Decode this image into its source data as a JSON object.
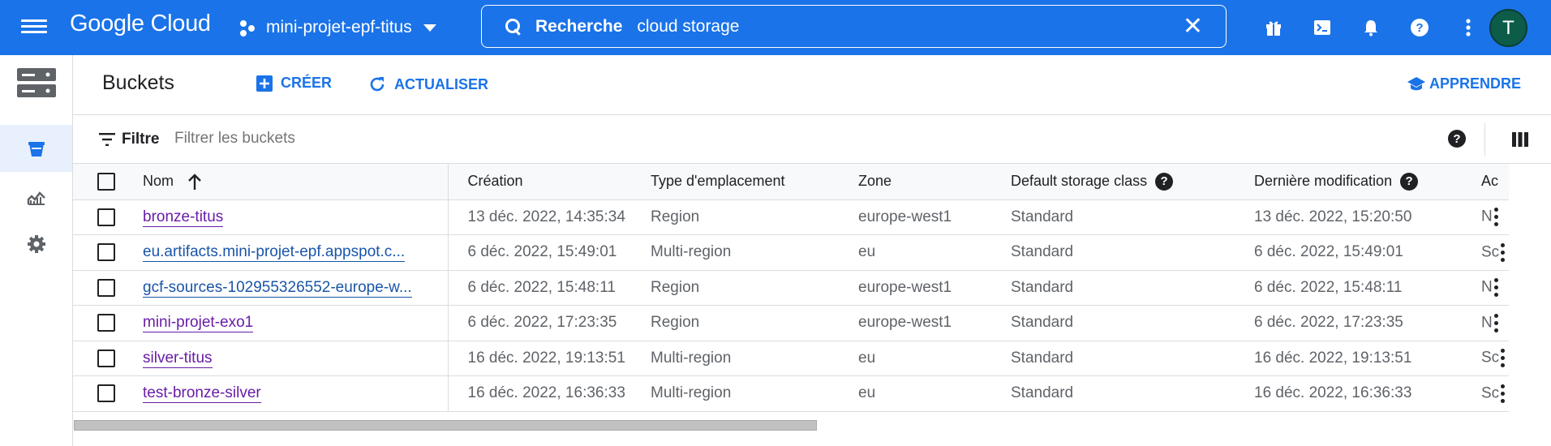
{
  "header": {
    "logo": "Google Cloud",
    "project": "mini-projet-epf-titus",
    "search_label": "Recherche",
    "search_value": "cloud storage",
    "avatar_letter": "T"
  },
  "toolbar": {
    "title": "Buckets",
    "create_label": "CRÉER",
    "refresh_label": "ACTUALISER",
    "learn_label": "APPRENDRE"
  },
  "filter": {
    "label": "Filtre",
    "placeholder": "Filtrer les buckets"
  },
  "table": {
    "columns": {
      "name": "Nom",
      "created": "Création",
      "location_type": "Type d'emplacement",
      "zone": "Zone",
      "storage_class": "Default storage class",
      "modified": "Dernière modification",
      "access": "Ac"
    },
    "rows": [
      {
        "name": "bronze-titus",
        "created": "13 déc. 2022, 14:35:34",
        "location_type": "Region",
        "zone": "europe-west1",
        "storage_class": "Standard",
        "modified": "13 déc. 2022, 15:20:50",
        "access": "N"
      },
      {
        "name": "eu.artifacts.mini-projet-epf.appspot.c...",
        "created": "6 déc. 2022, 15:49:01",
        "location_type": "Multi-region",
        "zone": "eu",
        "storage_class": "Standard",
        "modified": "6 déc. 2022, 15:49:01",
        "access": "Sc"
      },
      {
        "name": "gcf-sources-102955326552-europe-w...",
        "created": "6 déc. 2022, 15:48:11",
        "location_type": "Region",
        "zone": "europe-west1",
        "storage_class": "Standard",
        "modified": "6 déc. 2022, 15:48:11",
        "access": "N"
      },
      {
        "name": "mini-projet-exo1",
        "created": "6 déc. 2022, 17:23:35",
        "location_type": "Region",
        "zone": "europe-west1",
        "storage_class": "Standard",
        "modified": "6 déc. 2022, 17:23:35",
        "access": "N"
      },
      {
        "name": "silver-titus",
        "created": "16 déc. 2022, 19:13:51",
        "location_type": "Multi-region",
        "zone": "eu",
        "storage_class": "Standard",
        "modified": "16 déc. 2022, 19:13:51",
        "access": "Sc"
      },
      {
        "name": "test-bronze-silver",
        "created": "16 déc. 2022, 16:36:33",
        "location_type": "Multi-region",
        "zone": "eu",
        "storage_class": "Standard",
        "modified": "16 déc. 2022, 16:36:33",
        "access": "Sc"
      }
    ]
  },
  "colors": {
    "brand_blue": "#1a73e8",
    "visited_link": "#681da8",
    "avatar_bg": "#0d5c4a"
  }
}
